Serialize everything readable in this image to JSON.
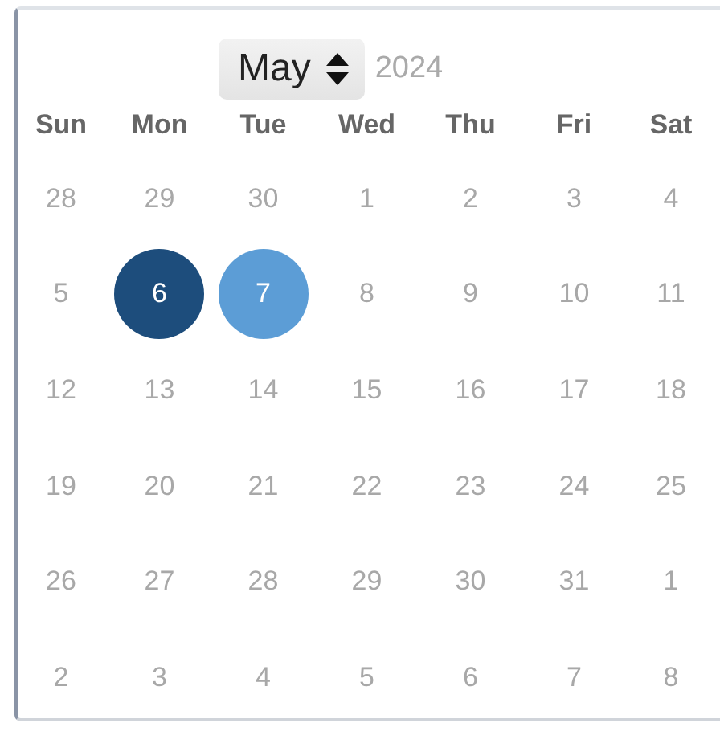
{
  "month_select": {
    "value": "May"
  },
  "year": "2024",
  "weekdays": [
    "Sun",
    "Mon",
    "Tue",
    "Wed",
    "Thu",
    "Fri",
    "Sat"
  ],
  "weeks": [
    [
      {
        "label": "28",
        "disabled": true,
        "selected": false,
        "in_range": false
      },
      {
        "label": "29",
        "disabled": true,
        "selected": false,
        "in_range": false
      },
      {
        "label": "30",
        "disabled": true,
        "selected": false,
        "in_range": false
      },
      {
        "label": "1",
        "disabled": true,
        "selected": false,
        "in_range": false
      },
      {
        "label": "2",
        "disabled": true,
        "selected": false,
        "in_range": false
      },
      {
        "label": "3",
        "disabled": true,
        "selected": false,
        "in_range": false
      },
      {
        "label": "4",
        "disabled": true,
        "selected": false,
        "in_range": false
      }
    ],
    [
      {
        "label": "5",
        "disabled": true,
        "selected": false,
        "in_range": false
      },
      {
        "label": "6",
        "disabled": false,
        "selected": true,
        "in_range": false
      },
      {
        "label": "7",
        "disabled": false,
        "selected": false,
        "in_range": true
      },
      {
        "label": "8",
        "disabled": true,
        "selected": false,
        "in_range": false
      },
      {
        "label": "9",
        "disabled": true,
        "selected": false,
        "in_range": false
      },
      {
        "label": "10",
        "disabled": true,
        "selected": false,
        "in_range": false
      },
      {
        "label": "11",
        "disabled": true,
        "selected": false,
        "in_range": false
      }
    ],
    [
      {
        "label": "12",
        "disabled": true,
        "selected": false,
        "in_range": false
      },
      {
        "label": "13",
        "disabled": true,
        "selected": false,
        "in_range": false
      },
      {
        "label": "14",
        "disabled": true,
        "selected": false,
        "in_range": false
      },
      {
        "label": "15",
        "disabled": true,
        "selected": false,
        "in_range": false
      },
      {
        "label": "16",
        "disabled": true,
        "selected": false,
        "in_range": false
      },
      {
        "label": "17",
        "disabled": true,
        "selected": false,
        "in_range": false
      },
      {
        "label": "18",
        "disabled": true,
        "selected": false,
        "in_range": false
      }
    ],
    [
      {
        "label": "19",
        "disabled": true,
        "selected": false,
        "in_range": false
      },
      {
        "label": "20",
        "disabled": true,
        "selected": false,
        "in_range": false
      },
      {
        "label": "21",
        "disabled": true,
        "selected": false,
        "in_range": false
      },
      {
        "label": "22",
        "disabled": true,
        "selected": false,
        "in_range": false
      },
      {
        "label": "23",
        "disabled": true,
        "selected": false,
        "in_range": false
      },
      {
        "label": "24",
        "disabled": true,
        "selected": false,
        "in_range": false
      },
      {
        "label": "25",
        "disabled": true,
        "selected": false,
        "in_range": false
      }
    ],
    [
      {
        "label": "26",
        "disabled": true,
        "selected": false,
        "in_range": false
      },
      {
        "label": "27",
        "disabled": true,
        "selected": false,
        "in_range": false
      },
      {
        "label": "28",
        "disabled": true,
        "selected": false,
        "in_range": false
      },
      {
        "label": "29",
        "disabled": true,
        "selected": false,
        "in_range": false
      },
      {
        "label": "30",
        "disabled": true,
        "selected": false,
        "in_range": false
      },
      {
        "label": "31",
        "disabled": true,
        "selected": false,
        "in_range": false
      },
      {
        "label": "1",
        "disabled": true,
        "selected": false,
        "in_range": false
      }
    ],
    [
      {
        "label": "2",
        "disabled": true,
        "selected": false,
        "in_range": false
      },
      {
        "label": "3",
        "disabled": true,
        "selected": false,
        "in_range": false
      },
      {
        "label": "4",
        "disabled": true,
        "selected": false,
        "in_range": false
      },
      {
        "label": "5",
        "disabled": true,
        "selected": false,
        "in_range": false
      },
      {
        "label": "6",
        "disabled": true,
        "selected": false,
        "in_range": false
      },
      {
        "label": "7",
        "disabled": true,
        "selected": false,
        "in_range": false
      },
      {
        "label": "8",
        "disabled": true,
        "selected": false,
        "in_range": false
      }
    ]
  ]
}
